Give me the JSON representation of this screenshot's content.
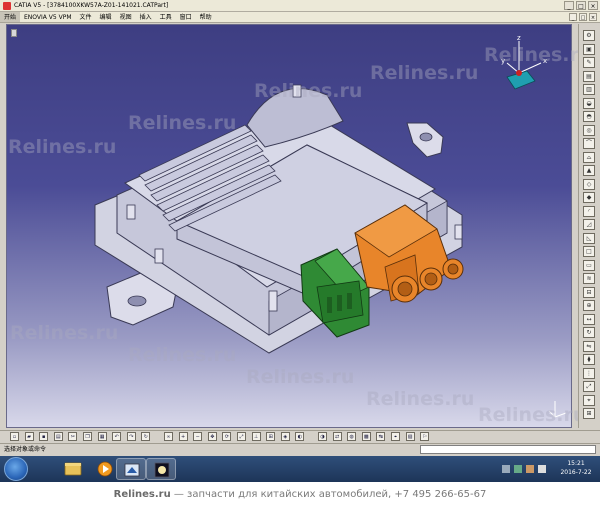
{
  "window": {
    "title": "CATIA V5 - [3784100XKW57A-Z01-141021.CATPart]",
    "controls": [
      "_",
      "□",
      "×"
    ]
  },
  "menubar": {
    "items": [
      "开始",
      "ENOVIA V5 VPM",
      "文件",
      "编辑",
      "视图",
      "插入",
      "工具",
      "窗口",
      "帮助"
    ],
    "doc_controls": [
      "_",
      "□",
      "×"
    ]
  },
  "compass": {
    "axis_labels": [
      "z",
      "x",
      "y"
    ]
  },
  "watermark": {
    "text": "Relines.ru"
  },
  "right_toolbar": {
    "icons": [
      "settings-icon",
      "part-body-icon",
      "sketch-icon",
      "pad-icon",
      "pocket-icon",
      "shaft-icon",
      "groove-icon",
      "hole-icon",
      "rib-icon",
      "slot-icon",
      "stiffener-icon",
      "loft-icon",
      "remove-loft-icon",
      "fillet-icon",
      "chamfer-icon",
      "draft-icon",
      "shell-icon",
      "thickness-icon",
      "thread-icon",
      "remove-face-icon",
      "boolean-icon",
      "translate-icon",
      "rotate-icon",
      "symmetry-icon",
      "mirror-icon",
      "pattern-icon",
      "scale-icon",
      "measure-icon",
      "analysis-icon"
    ]
  },
  "bottom_toolbar": {
    "icons": [
      "new-icon",
      "open-icon",
      "save-icon",
      "print-icon",
      "cut-icon",
      "copy-icon",
      "paste-icon",
      "undo-icon",
      "redo-icon",
      "update-icon",
      "link-icon",
      "zoom-in-icon",
      "zoom-out-icon",
      "pan-icon",
      "rotate-view-icon",
      "fit-all-icon",
      "normal-view-icon",
      "multi-view-icon",
      "iso-view-icon",
      "shading-icon",
      "hide-show-icon",
      "swap-icon",
      "render-icon",
      "material-icon",
      "measure-between-icon",
      "measure-item-icon",
      "catalog-icon",
      "knowledge-icon"
    ]
  },
  "statusbar": {
    "text": "选择对象或命令"
  },
  "taskbar": {
    "clock_time": "15:21",
    "clock_date": "2016-7-22"
  },
  "footer": {
    "brand": "Relines.ru",
    "text": " — запчасти для китайских автомобилей, +7 495 266-65-67"
  },
  "colors": {
    "viewport_top": "#3e3e82",
    "viewport_bottom": "#d8d8ea",
    "housing": "#d6d6e4",
    "connector_orange": "#e8852a",
    "connector_green": "#2f8a34"
  }
}
